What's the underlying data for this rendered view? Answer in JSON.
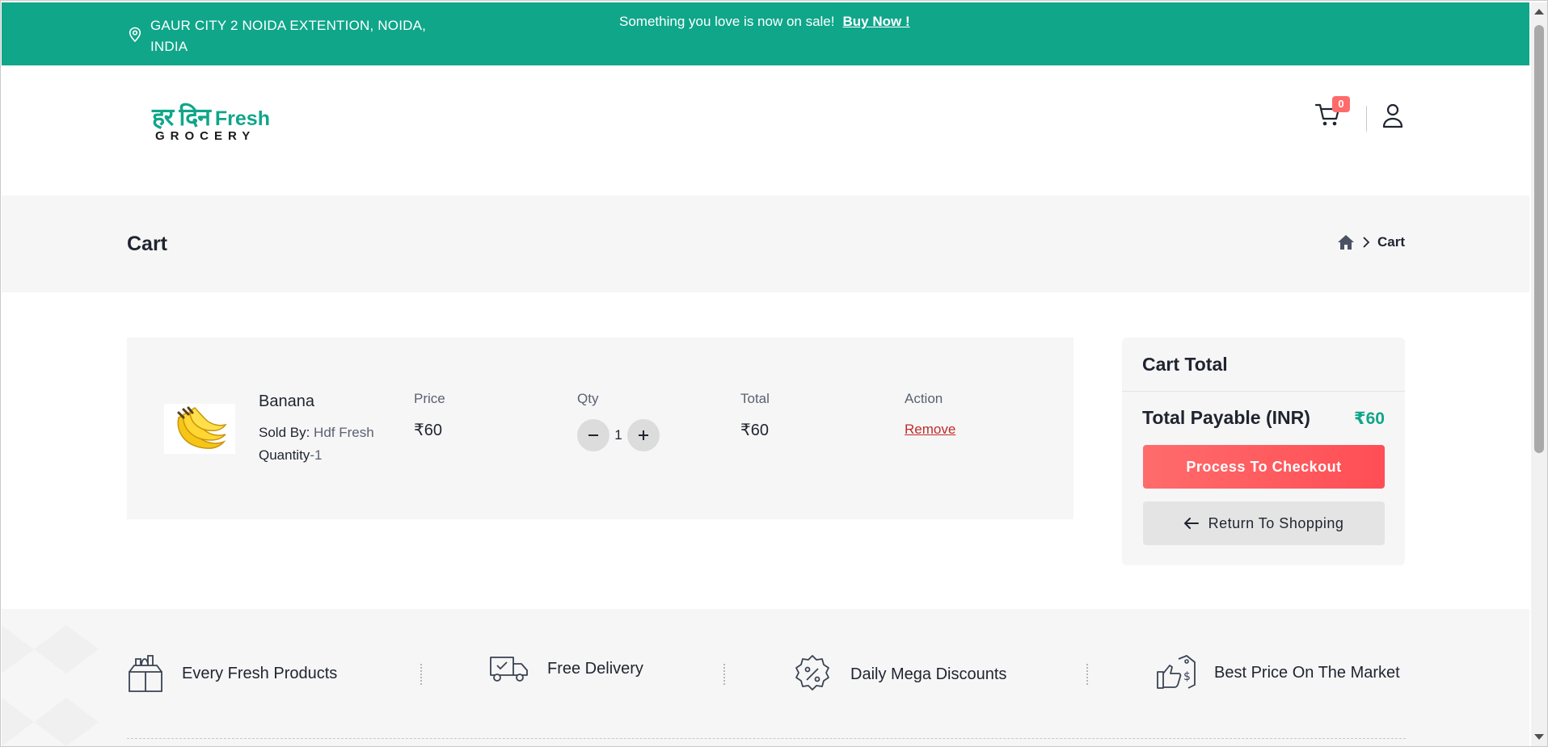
{
  "topbar": {
    "location": "GAUR CITY 2 NOIDA EXTENTION, NOIDA, INDIA",
    "promo_text": "Something you love is now on sale!",
    "promo_link": "Buy Now !"
  },
  "header": {
    "logo_hindi": "हर दिन",
    "logo_fresh": "Fresh",
    "logo_sub": "GROCERY",
    "cart_count": "0"
  },
  "page": {
    "title": "Cart",
    "breadcrumb_current": "Cart"
  },
  "cart_item": {
    "name": "Banana",
    "sold_by_label": "Sold By:",
    "sold_by": "Hdf Fresh",
    "quantity_label": "Quantity",
    "quantity_text": "-1",
    "price_label": "Price",
    "price": "₹60",
    "qty_label": "Qty",
    "qty": "1",
    "total_label": "Total",
    "total": "₹60",
    "action_label": "Action",
    "remove": "Remove"
  },
  "cart_total": {
    "title": "Cart Total",
    "payable_label": "Total Payable (INR)",
    "payable_value": "₹60",
    "checkout": "Process To Checkout",
    "return": "Return To Shopping"
  },
  "features": [
    {
      "label": "Every Fresh Products",
      "icon": "grocery-box-icon"
    },
    {
      "label": "Free Delivery",
      "icon": "delivery-truck-icon"
    },
    {
      "label": "Daily Mega Discounts",
      "icon": "discount-badge-icon"
    },
    {
      "label": "Best Price On The Market",
      "icon": "price-tag-hand-icon"
    }
  ],
  "colors": {
    "brand": "#0fa68a",
    "accent": "#ff5a5f",
    "remove": "#c02a2a"
  }
}
